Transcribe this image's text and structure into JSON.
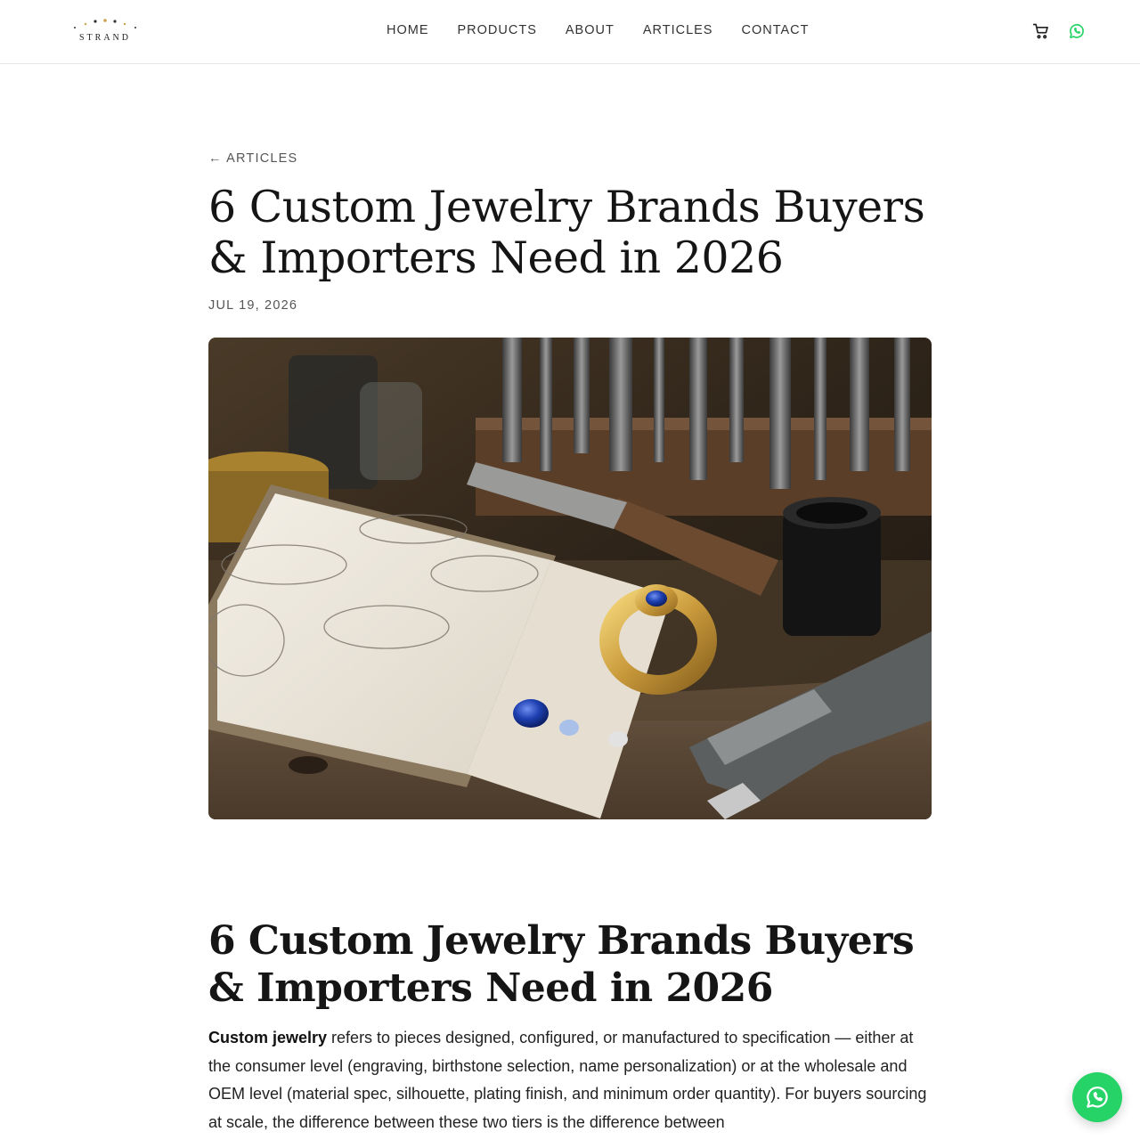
{
  "brand": {
    "name": "STRAND"
  },
  "nav": {
    "items": [
      {
        "label": "HOME"
      },
      {
        "label": "PRODUCTS"
      },
      {
        "label": "ABOUT"
      },
      {
        "label": "ARTICLES"
      },
      {
        "label": "CONTACT"
      }
    ]
  },
  "header_icons": [
    "cart-icon",
    "whatsapp-icon"
  ],
  "article": {
    "back_link": "← ARTICLES",
    "title": "6 Custom Jewelry Brands Buyers & Importers Need in 2026",
    "date": "JUL 19, 2026",
    "hero_image": "workbench with ring sketches, gold sapphire ring, loose gemstones and tools",
    "body_heading": "6 Custom Jewelry Brands Buyers & Importers Need in 2026",
    "intro_bold": "Custom jewelry",
    "intro_text": " refers to pieces designed, configured, or manufactured to specification — either at the consumer level (engraving, birthstone selection, name personalization) or at the wholesale and OEM level (material spec, silhouette, plating finish, and minimum order quantity). For buyers sourcing at scale, the difference between these two tiers is the difference between"
  },
  "colors": {
    "whatsapp": "#25d366",
    "text": "#151515",
    "muted": "#555555",
    "divider": "#e6e6e6"
  }
}
